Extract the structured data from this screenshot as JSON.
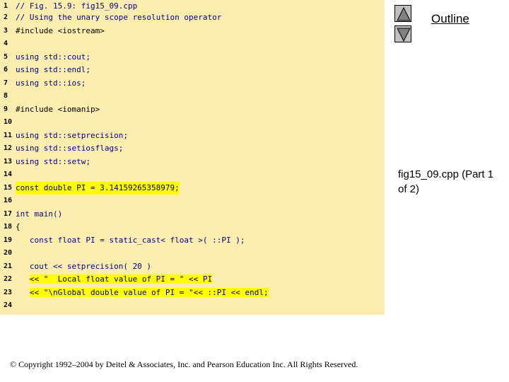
{
  "nav": {
    "up_icon": "triangle-up-icon",
    "down_icon": "triangle-down-icon",
    "outline_label": "Outline"
  },
  "slide": {
    "file_label": "fig15_09.cpp (Part 1 of 2)",
    "copyright": "© Copyright 1992–2004 by Deitel & Associates, Inc. and Pearson Education Inc. All Rights Reserved."
  },
  "code": {
    "highlight_color": "#ffff00",
    "background_color": "#fdeeb0",
    "lines": [
      {
        "num": "1",
        "text": "// Fig. 15.9: fig15_09.cpp"
      },
      {
        "num": "2",
        "text": "// Using the unary scope resolution operator"
      },
      {
        "num": "3",
        "text": "#include <iostream>"
      },
      {
        "num": "4",
        "text": ""
      },
      {
        "num": "5",
        "text": "using std::cout;"
      },
      {
        "num": "6",
        "text": "using std::endl;"
      },
      {
        "num": "7",
        "text": "using std::ios;"
      },
      {
        "num": "8",
        "text": ""
      },
      {
        "num": "9",
        "text": "#include <iomanip>"
      },
      {
        "num": "10",
        "text": ""
      },
      {
        "num": "11",
        "text": "using std::setprecision;"
      },
      {
        "num": "12",
        "text": "using std::setiosflags;"
      },
      {
        "num": "13",
        "text": "using std::setw;"
      },
      {
        "num": "14",
        "text": ""
      },
      {
        "num": "15",
        "text": "const double PI = 3.14159265358979;"
      },
      {
        "num": "16",
        "text": ""
      },
      {
        "num": "17",
        "text": "int main()"
      },
      {
        "num": "18",
        "text": "{"
      },
      {
        "num": "19",
        "text": "   const float PI = static_cast< float >( ::PI );"
      },
      {
        "num": "20",
        "text": ""
      },
      {
        "num": "21",
        "text": "   cout << setprecision( 20 )"
      },
      {
        "num": "22",
        "text": "        << \"  Local float value of PI = \" << PI"
      },
      {
        "num": "23",
        "text": "        << \"\\nGlobal double value of PI = \"<< ::PI << endl;"
      },
      {
        "num": "24",
        "text": ""
      }
    ]
  }
}
